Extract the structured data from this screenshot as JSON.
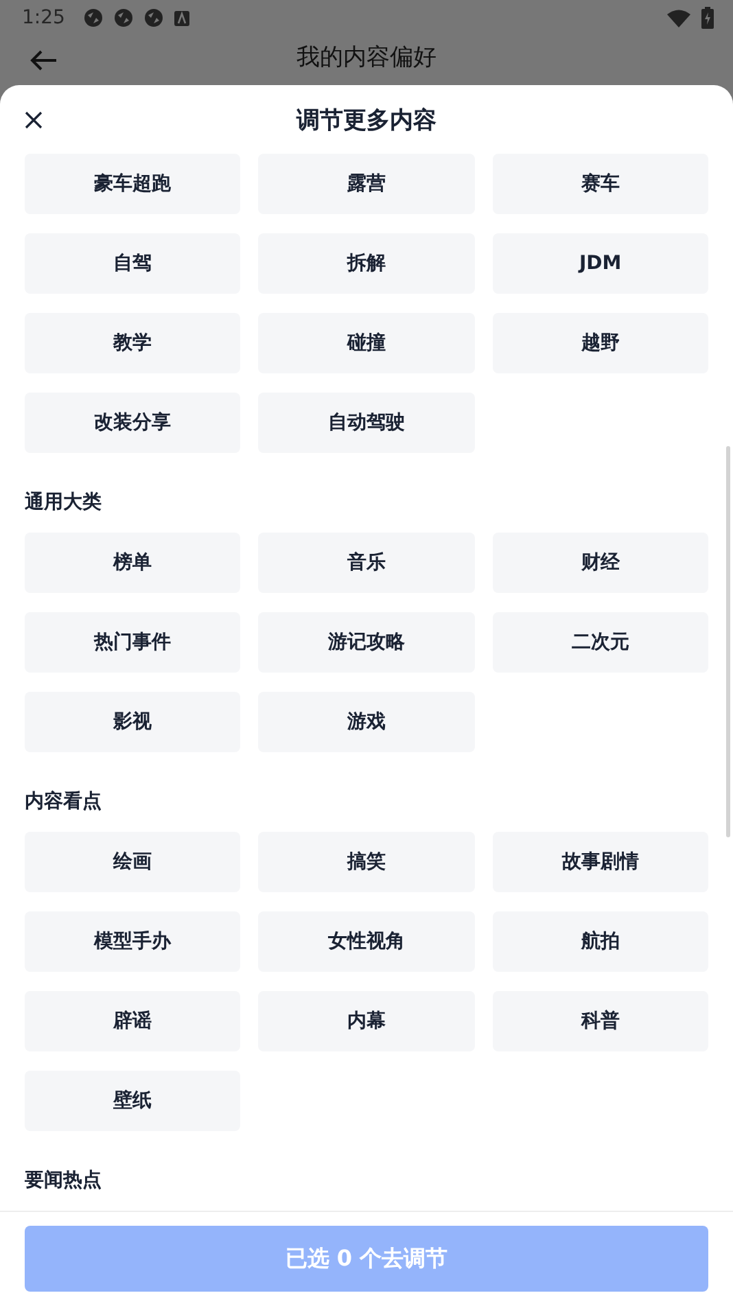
{
  "status_bar": {
    "time": "1:25"
  },
  "app_bar": {
    "title": "我的内容偏好"
  },
  "sheet": {
    "title": "调节更多内容",
    "sections": [
      {
        "tags": [
          {
            "label": "豪车超跑",
            "selected": false
          },
          {
            "label": "露营",
            "selected": false
          },
          {
            "label": "赛车",
            "selected": false
          },
          {
            "label": "自驾",
            "selected": false
          },
          {
            "label": "拆解",
            "selected": false
          },
          {
            "label": "JDM",
            "selected": false
          },
          {
            "label": "教学",
            "selected": false
          },
          {
            "label": "碰撞",
            "selected": false
          },
          {
            "label": "越野",
            "selected": false
          },
          {
            "label": "改装分享",
            "selected": false
          },
          {
            "label": "自动驾驶",
            "selected": false
          }
        ]
      },
      {
        "heading": "通用大类",
        "tags": [
          {
            "label": "榜单",
            "selected": false
          },
          {
            "label": "音乐",
            "selected": false
          },
          {
            "label": "财经",
            "selected": false
          },
          {
            "label": "热门事件",
            "selected": false
          },
          {
            "label": "游记攻略",
            "selected": false
          },
          {
            "label": "二次元",
            "selected": false
          },
          {
            "label": "影视",
            "selected": false
          },
          {
            "label": "游戏",
            "selected": false
          }
        ]
      },
      {
        "heading": "内容看点",
        "tags": [
          {
            "label": "绘画",
            "selected": false
          },
          {
            "label": "搞笑",
            "selected": false
          },
          {
            "label": "故事剧情",
            "selected": false
          },
          {
            "label": "模型手办",
            "selected": false
          },
          {
            "label": "女性视角",
            "selected": false
          },
          {
            "label": "航拍",
            "selected": false
          },
          {
            "label": "辟谣",
            "selected": false
          },
          {
            "label": "内幕",
            "selected": false
          },
          {
            "label": "科普",
            "selected": false
          },
          {
            "label": "壁纸",
            "selected": false
          }
        ]
      },
      {
        "heading": "要闻热点"
      }
    ],
    "confirm_button": {
      "label": "已选 0 个去调节",
      "disabled": true
    }
  }
}
